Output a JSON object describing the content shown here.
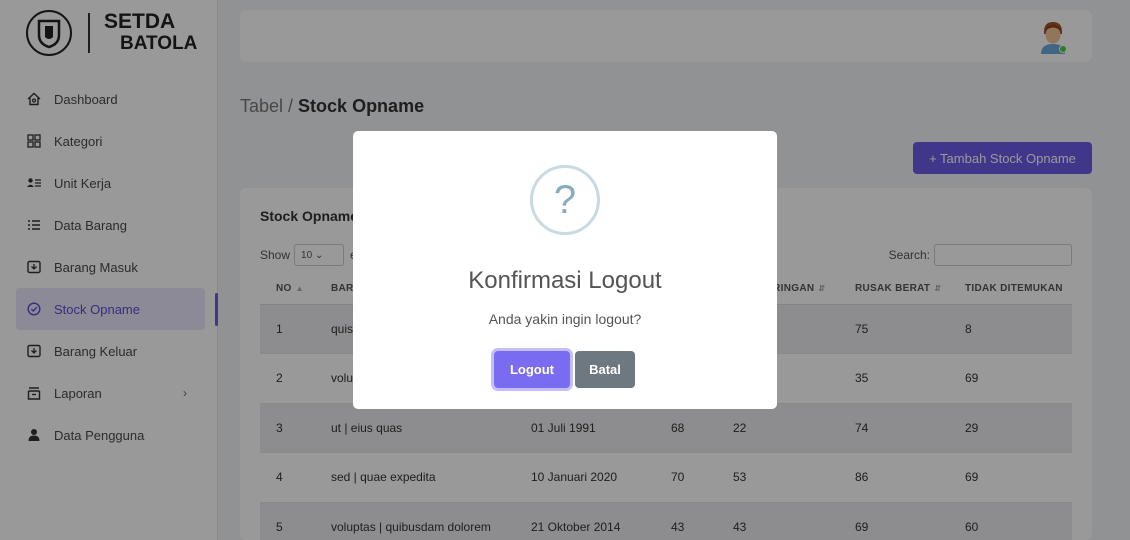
{
  "brand": {
    "line1": "SETDA",
    "line2": "BATOLA"
  },
  "sidebar": {
    "items": [
      {
        "label": "Dashboard",
        "icon": "home-icon"
      },
      {
        "label": "Kategori",
        "icon": "grid-icon"
      },
      {
        "label": "Unit Kerja",
        "icon": "user-list-icon"
      },
      {
        "label": "Data Barang",
        "icon": "list-icon"
      },
      {
        "label": "Barang Masuk",
        "icon": "inbox-icon"
      },
      {
        "label": "Stock Opname",
        "icon": "check-circle-icon",
        "active": true
      },
      {
        "label": "Barang Keluar",
        "icon": "inbox-icon"
      },
      {
        "label": "Laporan",
        "icon": "archive-icon"
      },
      {
        "label": "Data Pengguna",
        "icon": "user-icon"
      }
    ]
  },
  "breadcrumb": {
    "parent": "Tabel / ",
    "current": "Stock Opname"
  },
  "add_button": "+ Tambah Stock Opname",
  "card": {
    "title": "Stock Opname",
    "show_label": "Show",
    "show_value": "10",
    "show_suffix": "e",
    "search_label": "Search:"
  },
  "table": {
    "headers": [
      "NO",
      "BARANG",
      "",
      "",
      "RUSAK RINGAN",
      "RUSAK BERAT",
      "TIDAK DITEMUKAN"
    ],
    "rows": [
      [
        "1",
        "quis",
        "",
        "",
        "",
        "75",
        "8"
      ],
      [
        "2",
        "volu",
        "",
        "",
        "",
        "35",
        "69"
      ],
      [
        "3",
        "ut | eius quas",
        "01 Juli 1991",
        "68",
        "22",
        "74",
        "29"
      ],
      [
        "4",
        "sed | quae expedita",
        "10 Januari 2020",
        "70",
        "53",
        "86",
        "69"
      ],
      [
        "5",
        "voluptas | quibusdam dolorem",
        "21 Oktober 2014",
        "43",
        "43",
        "69",
        "60"
      ]
    ]
  },
  "modal": {
    "icon": "?",
    "title": "Konfirmasi Logout",
    "text": "Anda yakin ingin logout?",
    "confirm": "Logout",
    "cancel": "Batal"
  },
  "colors": {
    "accent": "#6c5ce7",
    "cancel": "#6e7881"
  }
}
